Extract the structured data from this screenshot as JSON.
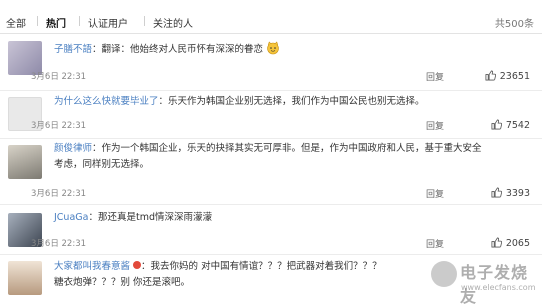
{
  "tabs": {
    "items": [
      "全部",
      "热门",
      "认证用户",
      "关注的人"
    ],
    "active_index": 1,
    "total": "共500条"
  },
  "comments": [
    {
      "user": "子膳不語",
      "text": "：翻译：他始终对人民币怀有深深的眷恋",
      "emoji": "cat-face",
      "time": "3月6日 22:31",
      "reply": "回复",
      "likes": "23651"
    },
    {
      "user": "为什么这么快就要毕业了",
      "text": "：乐天作为韩国企业别无选择，我们作为中国公民也别无选择。",
      "time": "3月6日 22:31",
      "reply": "回复",
      "likes": "7542"
    },
    {
      "user": "颜俊律师",
      "text_line1": "：作为一个韩国企业，乐天的抉择其实无可厚非。但是，作为中国政府和人民，基于重大安全",
      "text_line2": "考虑，同样别无选择。",
      "time": "3月6日 22:31",
      "reply": "回复",
      "likes": "3393"
    },
    {
      "user": "JCuaGa",
      "text": "：那还真是tmd情深深雨濛濛",
      "time": "3月6日 22:31",
      "reply": "回复",
      "likes": "2065"
    },
    {
      "user": "大家都叫我春意酱",
      "text_line1": "：我去你妈的 对中国有情谊？？？把武器对着我们？？？",
      "text_line2": "糖衣炮弹？？？别 你还是滚吧。"
    }
  ],
  "watermark": {
    "title": "电子发烧友",
    "url": "www.elecfans.com"
  },
  "colors": {
    "username": "#4a7fc1",
    "divider": "#ececec"
  }
}
